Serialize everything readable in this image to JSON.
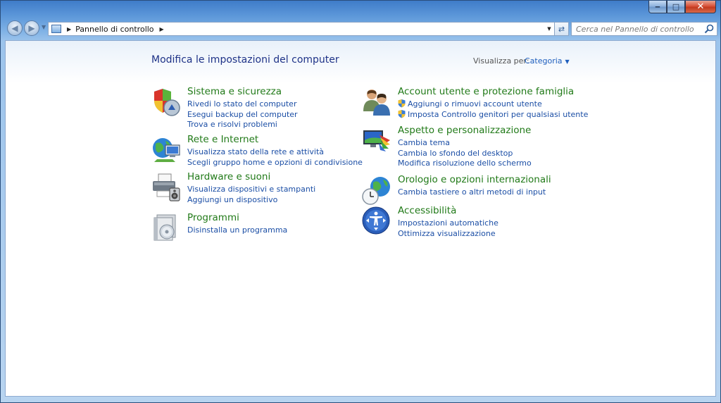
{
  "window": {
    "controls": {
      "minimize": "‒",
      "maximize": "□",
      "close": "✕"
    }
  },
  "navbar": {
    "breadcrumb_item": "Pannello di controllo",
    "search_placeholder": "Cerca nel Pannello di controllo"
  },
  "main": {
    "title": "Modifica le impostazioni del computer",
    "view_by_label": "Visualizza per:",
    "view_by_value": "Categoria"
  },
  "categories": {
    "sistema": {
      "title": "Sistema e sicurezza",
      "links": [
        "Rivedi lo stato del computer",
        "Esegui backup del computer",
        "Trova e risolvi problemi"
      ]
    },
    "rete": {
      "title": "Rete e Internet",
      "links": [
        "Visualizza stato della rete e attività",
        "Scegli gruppo home e opzioni di condivisione"
      ]
    },
    "hardware": {
      "title": "Hardware e suoni",
      "links": [
        "Visualizza dispositivi e stampanti",
        "Aggiungi un dispositivo"
      ]
    },
    "programmi": {
      "title": "Programmi",
      "links": [
        "Disinstalla un programma"
      ]
    },
    "account": {
      "title": "Account utente e protezione famiglia",
      "links": [
        "Aggiungi o rimuovi account utente",
        "Imposta Controllo genitori per qualsiasi utente"
      ]
    },
    "aspetto": {
      "title": "Aspetto e personalizzazione",
      "links": [
        "Cambia tema",
        "Cambia lo sfondo del desktop",
        "Modifica risoluzione dello schermo"
      ]
    },
    "orologio": {
      "title": "Orologio e opzioni internazionali",
      "links": [
        "Cambia tastiere o altri metodi di input"
      ]
    },
    "accessibilita": {
      "title": "Accessibilità",
      "links": [
        "Impostazioni automatiche",
        "Ottimizza visualizzazione"
      ]
    }
  }
}
